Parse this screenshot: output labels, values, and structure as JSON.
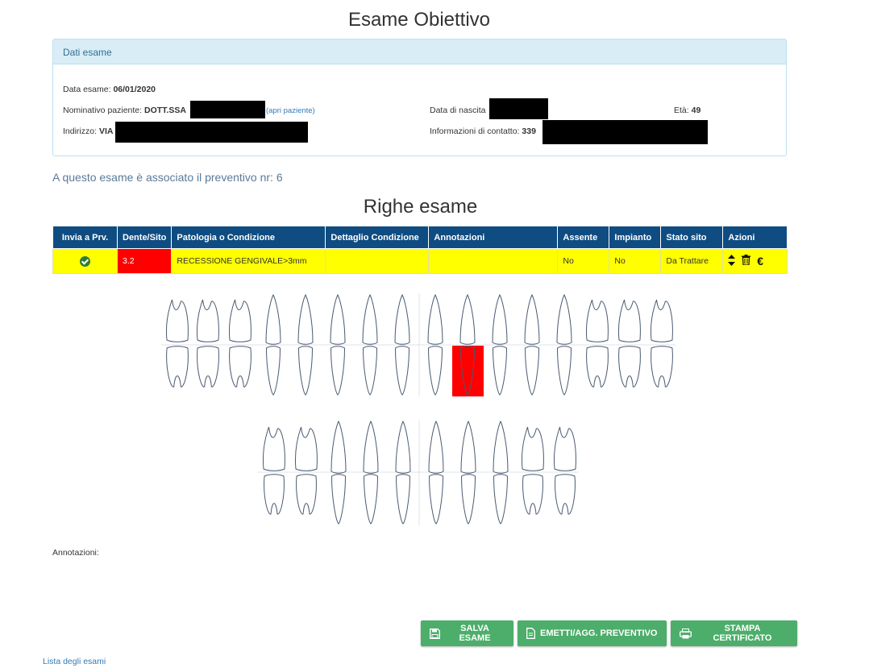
{
  "page": {
    "title": "Esame Obiettivo",
    "section_title": "Righe esame"
  },
  "exam_panel": {
    "heading": "Dati esame",
    "date_label": "Data esame:",
    "date_value": "06/01/2020",
    "patient_label": "Nominativo paziente:",
    "patient_value": "DOTT.SSA",
    "open_patient_link": "(apri paziente)",
    "birth_label": "Data di nascita",
    "age_label": "Età:",
    "age_value": "49",
    "address_label": "Indirizzo:",
    "address_value": "VIA",
    "contact_label": "Informazioni di contatto:",
    "contact_value": "339"
  },
  "estimate_note": "A questo esame è associato il preventivo nr: 6",
  "table": {
    "headers": [
      "Invia a Prv.",
      "Dente/Sito",
      "Patologia o Condizione",
      "Dettaglio Condizione",
      "Annotazioni",
      "Assente",
      "Impianto",
      "Stato sito",
      "Azioni"
    ],
    "rows": [
      {
        "tooth": "3.2",
        "condition": "RECESSIONE GENGIVALE>3mm",
        "detail": "",
        "notes": "",
        "absent": "No",
        "implant": "No",
        "status": "Da Trattare"
      }
    ]
  },
  "annotations_label": "Annotazioni:",
  "buttons": {
    "save": "SALVA ESAME",
    "estimate": "EMETTI/AGG. PREVENTIVO",
    "print": "STAMPA CERTIFICATO"
  },
  "footer_link": "Lista degli esami",
  "colors": {
    "header_blue": "#0f4c81",
    "row_yellow": "#ffff00",
    "highlight_red": "#ff0000",
    "button_green": "#4cae6a"
  },
  "icons": [
    "check-circle-icon",
    "sort-arrows-icon",
    "trash-icon",
    "euro-icon",
    "floppy-disk-icon",
    "document-icon",
    "printer-icon"
  ]
}
